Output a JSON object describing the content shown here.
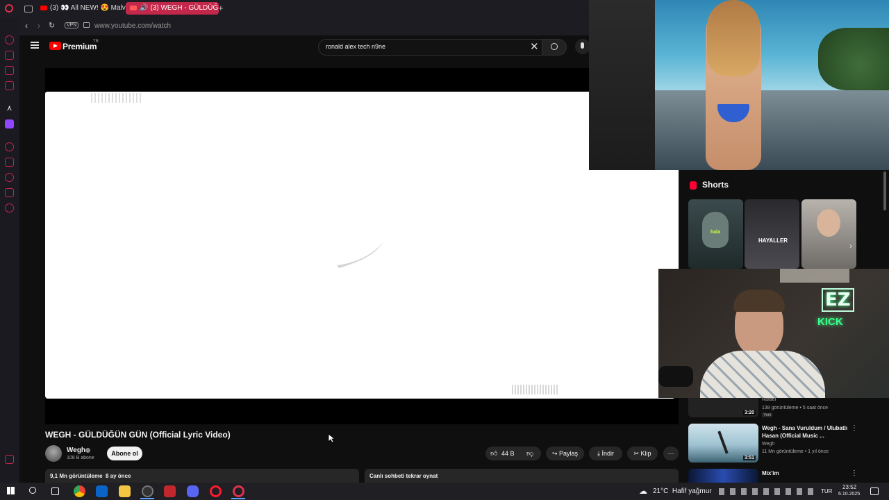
{
  "browser": {
    "tabs": [
      {
        "label": "(3) 👀 All NEW! 😍 Malve"
      },
      {
        "label": "(3) WEGH - GÜLDÜĞÜ"
      }
    ],
    "new_tab": "+",
    "vpn": "VPN",
    "url": "www.youtube.com/watch"
  },
  "youtube": {
    "logo": "Premium",
    "logo_sup": "TR",
    "search_value": "ronald alex tech n9ne"
  },
  "video": {
    "title": "WEGH - GÜLDÜĞÜN GÜN (Official Lyric Video)",
    "channel": "Wegh",
    "subs": "108 B abone",
    "subscribe": "Abone ol",
    "likes": "44 B",
    "share": "Paylaş",
    "download": "İndir",
    "clip": "Klip",
    "views": "9,1 Mn görüntüleme",
    "age": "8 ay önce",
    "chat_replay": "Canlı sohbeti tekrar oynat"
  },
  "shorts": {
    "title": "Shorts",
    "items": [
      {
        "caption": "hala"
      },
      {
        "caption": "HAYALLER"
      },
      {
        "caption": ""
      }
    ]
  },
  "stream_overlay": {
    "neon_top": "EZ",
    "neon_bottom": "KICK"
  },
  "related": [
    {
      "title": "",
      "channel": "Rafael",
      "meta": "138 görüntüleme • 5 saat önce",
      "badge": "Yeni",
      "duration": "3:20"
    },
    {
      "title": "Wegh - Sana Vuruldum / Ulubatlı Hasan (Official Music ...",
      "channel": "Wegh",
      "meta": "11 Mn görüntüleme • 1 yıl önce",
      "duration": "3:51"
    },
    {
      "title": "Mix'im",
      "channel": "",
      "meta": "",
      "duration": ""
    }
  ],
  "taskbar": {
    "weather": "21°C  Hafif yağmur",
    "lang": "TUR",
    "time": "23:52",
    "date": "6.10.2025"
  },
  "colors": {
    "youtube_red": "#ff0000",
    "opera_red": "#c3274a",
    "neon_green": "#39ff8a"
  }
}
